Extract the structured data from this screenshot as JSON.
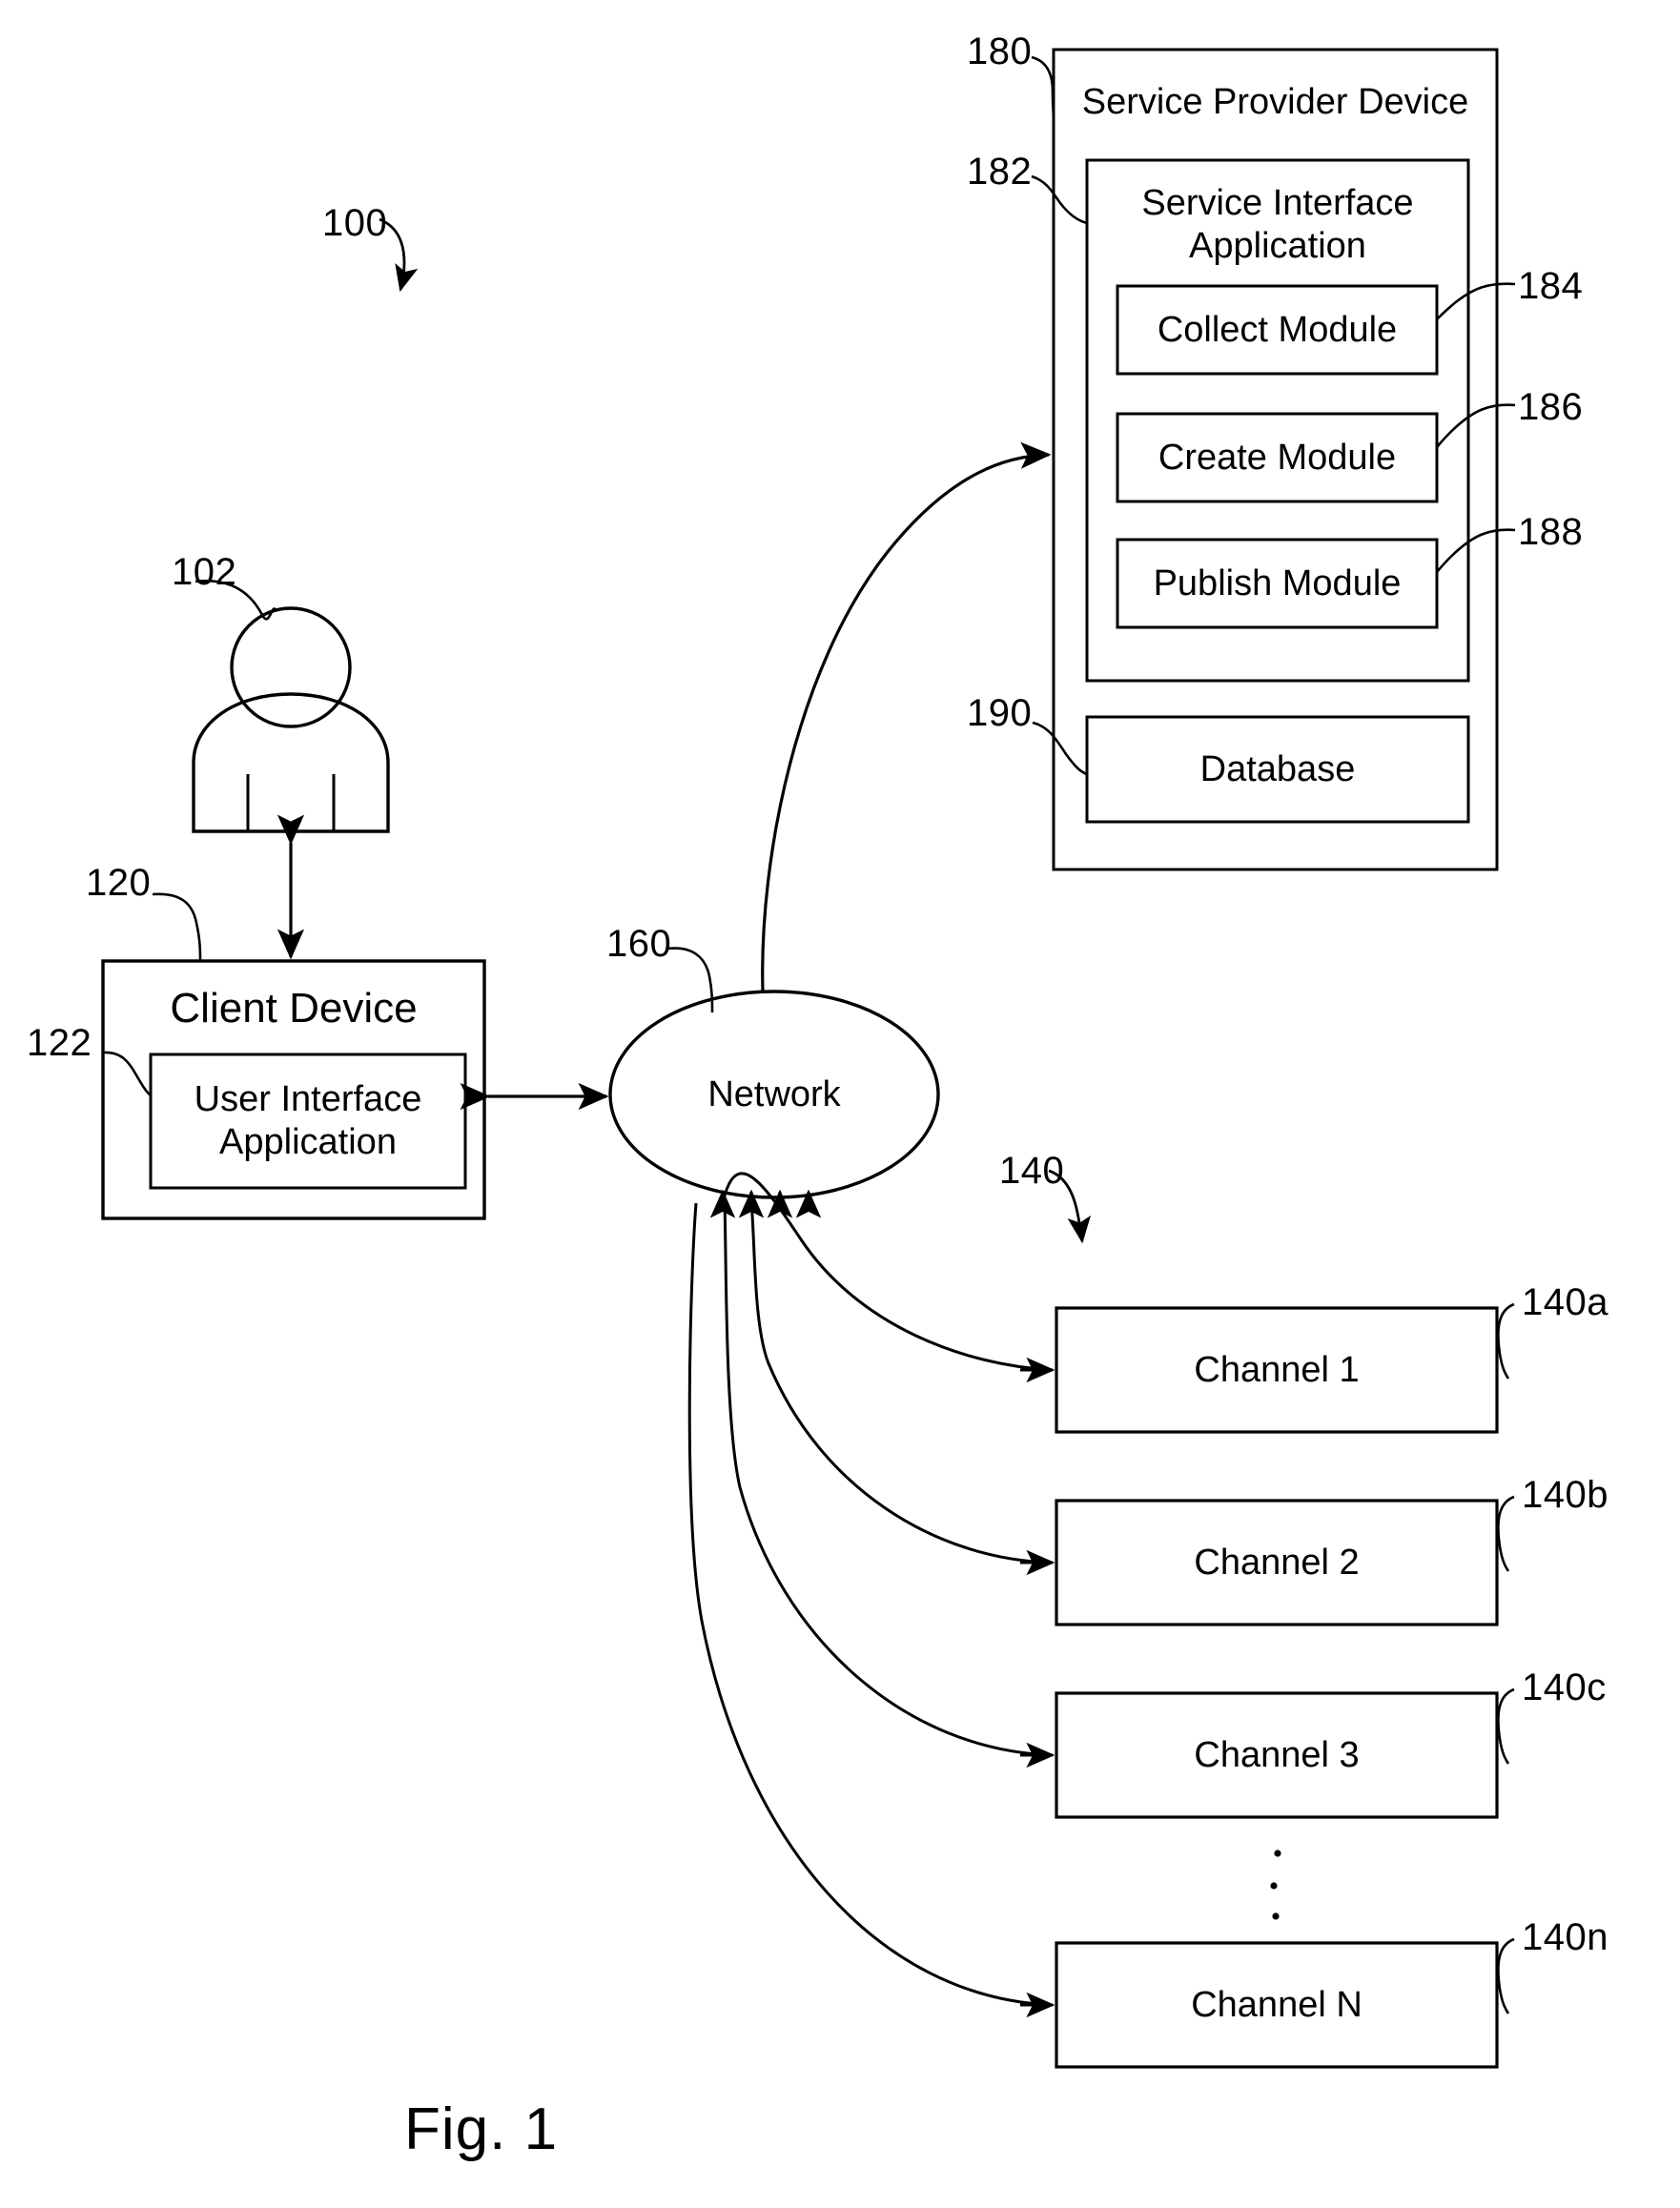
{
  "figure": {
    "caption": "Fig. 1",
    "system_ref": "100"
  },
  "user": {
    "ref": "102",
    "icon": "person-icon"
  },
  "client_device": {
    "ref": "120",
    "title": "Client Device",
    "app": {
      "ref": "122",
      "title": "User Interface\nApplication"
    }
  },
  "network": {
    "ref": "160",
    "label": "Network"
  },
  "service_provider_device": {
    "ref": "180",
    "title": "Service Provider Device",
    "service_interface_application": {
      "ref": "182",
      "title": "Service Interface\nApplication",
      "modules": [
        {
          "ref": "184",
          "label": "Collect Module"
        },
        {
          "ref": "186",
          "label": "Create Module"
        },
        {
          "ref": "188",
          "label": "Publish Module"
        }
      ]
    },
    "database": {
      "ref": "190",
      "label": "Database"
    }
  },
  "channels": {
    "ref": "140",
    "items": [
      {
        "ref": "140a",
        "label": "Channel 1"
      },
      {
        "ref": "140b",
        "label": "Channel 2"
      },
      {
        "ref": "140c",
        "label": "Channel 3"
      },
      {
        "ref": "140n",
        "label": "Channel N"
      }
    ],
    "ellipsis": "vertical-ellipsis"
  }
}
